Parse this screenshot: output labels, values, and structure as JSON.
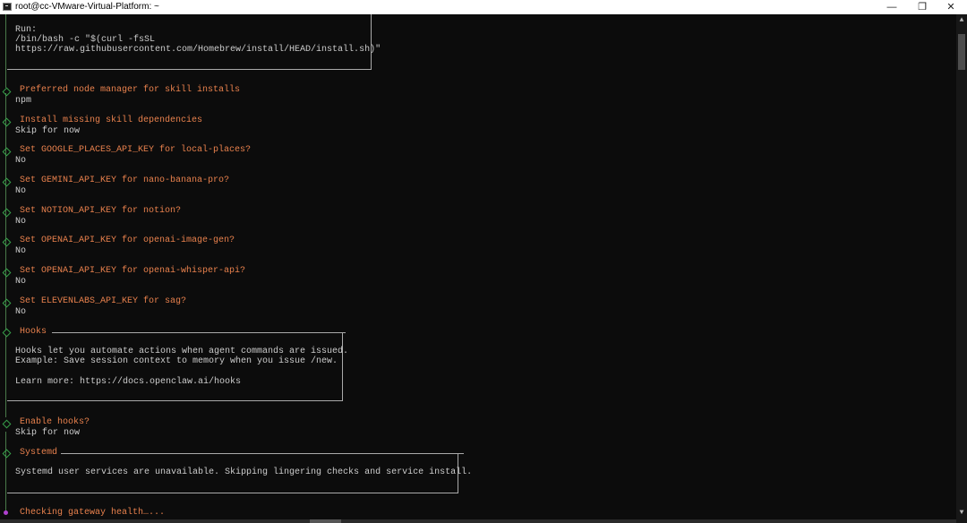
{
  "window": {
    "title": "root@cc-VMware-Virtual-Platform: ~",
    "minimize": "—",
    "maximize": "❐",
    "close": "✕"
  },
  "terminal": {
    "run_label": "Run:",
    "run_cmd1": "/bin/bash -c \"$(curl -fsSL",
    "run_cmd2": "https://raw.githubusercontent.com/Homebrew/install/HEAD/install.sh)\"",
    "prompts": [
      {
        "q": "Preferred node manager for skill installs",
        "a": "npm"
      },
      {
        "q": "Install missing skill dependencies",
        "a": "Skip for now"
      },
      {
        "q": "Set GOOGLE_PLACES_API_KEY for local-places?",
        "a": "No"
      },
      {
        "q": "Set GEMINI_API_KEY for nano-banana-pro?",
        "a": "No"
      },
      {
        "q": "Set NOTION_API_KEY for notion?",
        "a": "No"
      },
      {
        "q": "Set OPENAI_API_KEY for openai-image-gen?",
        "a": "No"
      },
      {
        "q": "Set OPENAI_API_KEY for openai-whisper-api?",
        "a": "No"
      },
      {
        "q": "Set ELEVENLABS_API_KEY for sag?",
        "a": "No"
      }
    ],
    "hooks": {
      "title": "Hooks",
      "line1": "Hooks let you automate actions when agent commands are issued.",
      "line2": "Example: Save session context to memory when you issue /new.",
      "line3": "Learn more: https://docs.openclaw.ai/hooks"
    },
    "enable_hooks": {
      "q": "Enable hooks?",
      "a": "Skip for now"
    },
    "systemd": {
      "title": "Systemd",
      "line1": "Systemd user services are unavailable. Skipping lingering checks and service install."
    },
    "status": "Checking gateway health…..."
  },
  "colors": {
    "background": "#0c0c0c",
    "text": "#cccccc",
    "prompt": "#e8814d",
    "marker": "#37a04a"
  }
}
